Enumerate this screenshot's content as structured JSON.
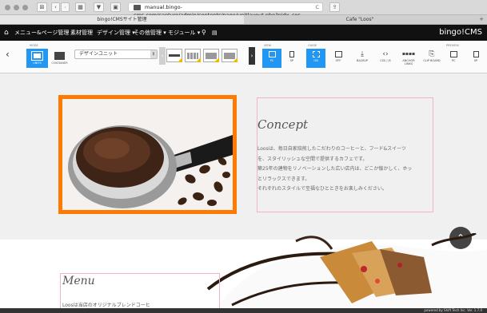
{
  "browser": {
    "url": "manual.bingo-cms.com/capture/admin/contents/page/unitlayout.php?pidx_cos",
    "tabs": [
      {
        "label": "bingo!CMSサイト管理"
      },
      {
        "label": "Cafe \"Loos\""
      }
    ],
    "new_tab": "+",
    "reload": "C"
  },
  "cms": {
    "menu": [
      {
        "label": "メニュー&ページ管理"
      },
      {
        "label": "素材管理"
      },
      {
        "label": "デザイン管理 ▾"
      },
      {
        "label": "その他管理 ▾"
      },
      {
        "label": "モジュール ▾"
      }
    ],
    "brand": "bingo!CMS"
  },
  "toolbar": {
    "mode_label": "MODE",
    "modes": [
      {
        "label": "UNITS",
        "active": true
      },
      {
        "label": "CONTAINER",
        "active": false
      }
    ],
    "design_unit_select": "デザインユニット",
    "view_label": "VIEW",
    "view_buttons": [
      {
        "label": "PC",
        "active": true
      },
      {
        "label": "SP",
        "active": false
      }
    ],
    "guide_label": "GUIDE",
    "guide_buttons": [
      {
        "label": "ON",
        "active": true
      },
      {
        "label": "OFF",
        "active": false
      }
    ],
    "actions": [
      {
        "label": "BACKUP",
        "glyph": "⤓"
      },
      {
        "label": "CSS / JS",
        "glyph": "‹›"
      },
      {
        "label": "ANCHOR LINKS",
        "glyph": "▪▪▪▪"
      },
      {
        "label": "CLIP BOARD",
        "glyph": "⎘"
      }
    ],
    "preview_label": "PREVIEW",
    "preview_buttons": [
      {
        "label": "PC"
      },
      {
        "label": "SP"
      }
    ]
  },
  "concept": {
    "title": "Concept",
    "lines": [
      "Loosは、毎日自家焙煎したこだわりのコーヒーと、フード&スイーツ",
      "を、スタイリッシュな空間で提供するカフェです。",
      "築25年の建物をリノベーションした広い店内は、どこか懐かしく、ホッ",
      "とリラックスできます。",
      "それぞれのスタイルで至福なひとときをお楽しみください。"
    ]
  },
  "menu_section": {
    "title": "Menu",
    "body": "Loosは当店のオリジナルブレンドコーヒ"
  },
  "footer": "powered by Shift Tech Inc. Ver. 1.7.0",
  "colors": {
    "accent_blue": "#2196f3",
    "frame_orange": "#ff7a00",
    "guide_pink": "#f2b4c2",
    "header_black": "#111111"
  }
}
